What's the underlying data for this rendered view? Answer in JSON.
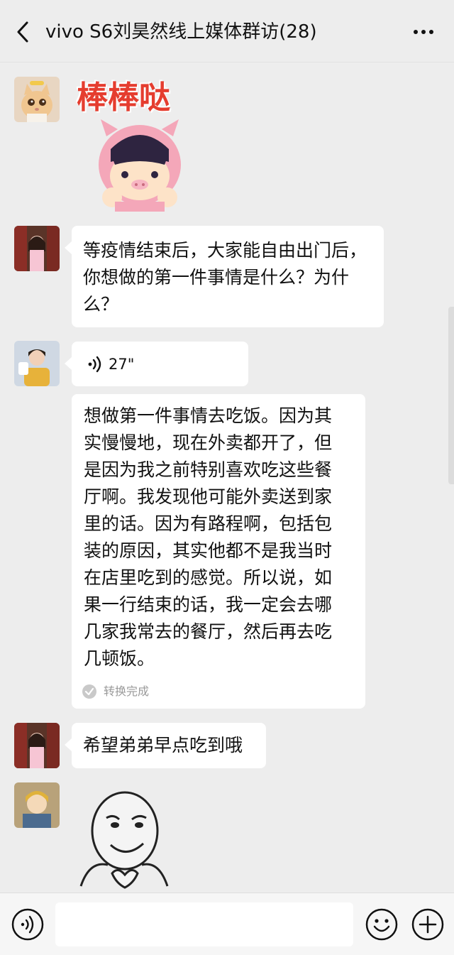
{
  "header": {
    "title": "vivo S6刘昊然线上媒体群访(28)"
  },
  "messages": [
    {
      "type": "sticker",
      "sticker_text": "棒棒哒"
    },
    {
      "type": "text",
      "text": "等疫情结束后，大家能自由出门后，\n你想做的第一件事情是什么？为什\n么？"
    },
    {
      "type": "voice",
      "duration": "27\"",
      "transcript": "想做第一件事情去吃饭。因为其\n实慢慢地，现在外卖都开了，但\n是因为我之前特别喜欢吃这些餐\n厅啊。我发现他可能外卖送到家\n里的话。因为有路程啊，包括包\n装的原因，其实他都不是我当时\n在店里吃到的感觉。所以说，如\n果一行结束的话，我一定会去哪\n几家我常去的餐厅，然后再去吃\n几顿饭。",
      "transcript_status": "转换完成"
    },
    {
      "type": "text",
      "text": "希望弟弟早点吃到哦"
    },
    {
      "type": "sticker",
      "sticker_text": ""
    }
  ],
  "colors": {
    "background": "#ededed",
    "bubble": "#ffffff",
    "sticker_red": "#e53d2f",
    "sticker_pink": "#f4a7b9"
  }
}
